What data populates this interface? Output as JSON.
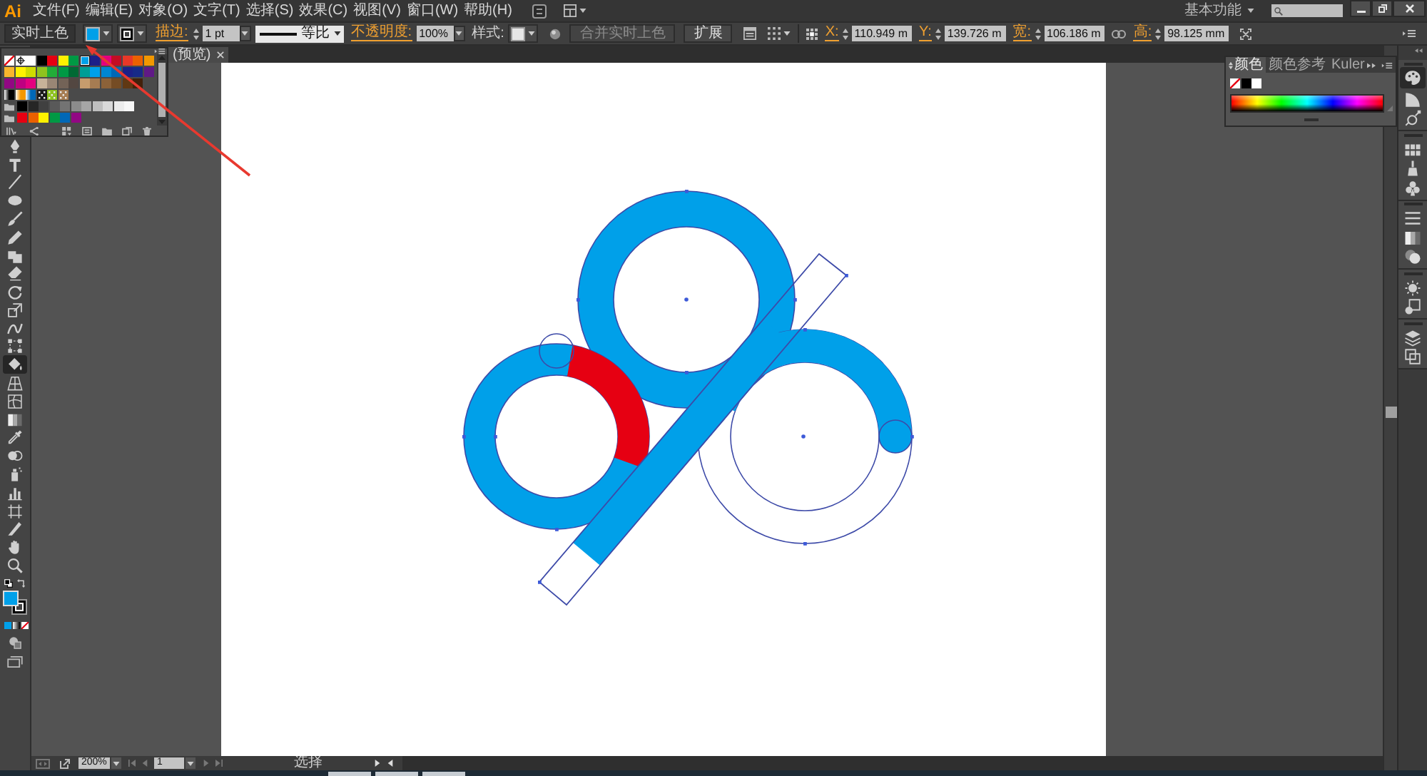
{
  "menu_bar": {
    "logo": "Ai",
    "items": [
      "文件(F)",
      "编辑(E)",
      "对象(O)",
      "文字(T)",
      "选择(S)",
      "效果(C)",
      "视图(V)",
      "窗口(W)",
      "帮助(H)"
    ],
    "workspace": "基本功能"
  },
  "control_bar": {
    "selection": "实时上色",
    "fill": {
      "color": "#00a0e9"
    },
    "stroke_link": "描边:",
    "stroke_weight": "1 pt",
    "stroke_profile": "等比",
    "opacity_link": "不透明度:",
    "opacity": "100%",
    "style_label": "样式:",
    "buttons": [
      {
        "label": "合并实时上色",
        "disabled": true
      },
      {
        "label": "扩展",
        "disabled": false
      }
    ],
    "transform": [
      {
        "label": "X:",
        "value": "110.949 m"
      },
      {
        "label": "Y:",
        "value": "139.726 m"
      },
      {
        "label": "宽:",
        "value": "106.186 m"
      },
      {
        "label": "高:",
        "value": "98.125 mm"
      }
    ]
  },
  "document_tab": {
    "title": "(预览)"
  },
  "swatches_panel": {
    "rows": [
      {
        "kind": "swatches",
        "swatches": [
          {
            "kind": "none",
            "selected": false
          },
          {
            "kind": "registration",
            "selected": false
          },
          {
            "kind": "solid",
            "color": "#ffffff",
            "selected": false
          },
          {
            "kind": "solid",
            "color": "#000000",
            "selected": false
          },
          {
            "kind": "solid",
            "color": "#e60012",
            "selected": false
          },
          {
            "kind": "solid",
            "color": "#fff100",
            "selected": false
          },
          {
            "kind": "solid",
            "color": "#009944",
            "selected": false
          },
          {
            "kind": "solid",
            "color": "#00a0e9",
            "selected": true
          },
          {
            "kind": "solid",
            "color": "#1d2088",
            "selected": false
          },
          {
            "kind": "solid",
            "color": "#e4007f",
            "selected": false
          },
          {
            "kind": "solid",
            "color": "#c30d23",
            "selected": false
          },
          {
            "kind": "solid",
            "color": "#e83828",
            "selected": false
          },
          {
            "kind": "solid",
            "color": "#eb6100",
            "selected": false
          },
          {
            "kind": "solid",
            "color": "#f39800",
            "selected": false
          }
        ]
      },
      {
        "kind": "swatches",
        "swatches": [
          {
            "kind": "solid",
            "color": "#f8b62d",
            "selected": false
          },
          {
            "kind": "solid",
            "color": "#fff100",
            "selected": false
          },
          {
            "kind": "solid",
            "color": "#cfdb00",
            "selected": false
          },
          {
            "kind": "solid",
            "color": "#8fc31f",
            "selected": false
          },
          {
            "kind": "solid",
            "color": "#22ac38",
            "selected": false
          },
          {
            "kind": "solid",
            "color": "#009944",
            "selected": false
          },
          {
            "kind": "solid",
            "color": "#006934",
            "selected": false
          },
          {
            "kind": "solid",
            "color": "#009e96",
            "selected": false
          },
          {
            "kind": "solid",
            "color": "#00a0e9",
            "selected": false
          },
          {
            "kind": "solid",
            "color": "#0086d1",
            "selected": false
          },
          {
            "kind": "solid",
            "color": "#0068b7",
            "selected": false
          },
          {
            "kind": "solid",
            "color": "#1d2088",
            "selected": false
          },
          {
            "kind": "solid",
            "color": "#172a88",
            "selected": false
          },
          {
            "kind": "solid",
            "color": "#601986",
            "selected": false
          }
        ]
      },
      {
        "kind": "swatches",
        "swatches": [
          {
            "kind": "solid",
            "color": "#920783",
            "selected": false
          },
          {
            "kind": "solid",
            "color": "#be0081",
            "selected": false
          },
          {
            "kind": "solid",
            "color": "#e4007f",
            "selected": false
          },
          {
            "kind": "solid",
            "color": "#c7b299",
            "selected": false
          },
          {
            "kind": "solid",
            "color": "#998675",
            "selected": false
          },
          {
            "kind": "solid",
            "color": "#736357",
            "selected": false
          },
          {
            "kind": "solid",
            "color": "#534741",
            "selected": false
          },
          {
            "kind": "solid",
            "color": "#c69c6d",
            "selected": false
          },
          {
            "kind": "solid",
            "color": "#a67c52",
            "selected": false
          },
          {
            "kind": "solid",
            "color": "#8c6239",
            "selected": false
          },
          {
            "kind": "solid",
            "color": "#754c24",
            "selected": false
          },
          {
            "kind": "solid",
            "color": "#603813",
            "selected": false
          },
          {
            "kind": "solid",
            "color": "#42210b",
            "selected": false
          }
        ]
      },
      {
        "kind": "swatches",
        "swatches": [
          {
            "kind": "gradient",
            "color": "#000000",
            "selected": false
          },
          {
            "kind": "gradient",
            "color": "#f39800",
            "selected": false
          },
          {
            "kind": "gradient",
            "color": "#0068b7",
            "selected": false
          },
          {
            "kind": "pattern",
            "color": "#1a1a1a",
            "selected": false
          },
          {
            "kind": "pattern",
            "color": "#8fc31f",
            "selected": false
          },
          {
            "kind": "pattern",
            "color": "#a67c52",
            "selected": false
          }
        ]
      },
      {
        "kind": "group",
        "swatches": [
          {
            "kind": "solid",
            "color": "#000000",
            "selected": false
          },
          {
            "kind": "solid",
            "color": "#262626",
            "selected": false
          },
          {
            "kind": "solid",
            "color": "#404040",
            "selected": false
          },
          {
            "kind": "solid",
            "color": "#595959",
            "selected": false
          },
          {
            "kind": "solid",
            "color": "#737373",
            "selected": false
          },
          {
            "kind": "solid",
            "color": "#8c8c8c",
            "selected": false
          },
          {
            "kind": "solid",
            "color": "#a6a6a6",
            "selected": false
          },
          {
            "kind": "solid",
            "color": "#bfbfbf",
            "selected": false
          },
          {
            "kind": "solid",
            "color": "#d9d9d9",
            "selected": false
          },
          {
            "kind": "solid",
            "color": "#ececec",
            "selected": false
          },
          {
            "kind": "solid",
            "color": "#f7f7f7",
            "selected": false
          }
        ]
      },
      {
        "kind": "group",
        "swatches": [
          {
            "kind": "solid",
            "color": "#e60012",
            "selected": false
          },
          {
            "kind": "solid",
            "color": "#eb6100",
            "selected": false
          },
          {
            "kind": "solid",
            "color": "#fff100",
            "selected": false
          },
          {
            "kind": "solid",
            "color": "#009944",
            "selected": false
          },
          {
            "kind": "solid",
            "color": "#0068b7",
            "selected": false
          },
          {
            "kind": "solid",
            "color": "#920783",
            "selected": false
          }
        ]
      }
    ]
  },
  "tools": [
    {
      "kind": "pen",
      "selected": false
    },
    {
      "kind": "type",
      "selected": false
    },
    {
      "kind": "line",
      "selected": false
    },
    {
      "kind": "ellipse",
      "selected": false
    },
    {
      "kind": "brush",
      "selected": false
    },
    {
      "kind": "pencil",
      "selected": false
    },
    {
      "kind": "blob",
      "selected": false
    },
    {
      "kind": "eraser",
      "selected": false
    },
    {
      "kind": "rotate",
      "selected": false
    },
    {
      "kind": "scale",
      "selected": false
    },
    {
      "kind": "warp",
      "selected": false
    },
    {
      "kind": "transform",
      "selected": false
    },
    {
      "kind": "bucket",
      "selected": true
    },
    {
      "kind": "perspective",
      "selected": false
    },
    {
      "kind": "mesh",
      "selected": false
    },
    {
      "kind": "gradient",
      "selected": false
    },
    {
      "kind": "eyedropper",
      "selected": false
    },
    {
      "kind": "blend",
      "selected": false
    },
    {
      "kind": "sprayer",
      "selected": false
    },
    {
      "kind": "graph",
      "selected": false
    },
    {
      "kind": "artboard",
      "selected": false
    },
    {
      "kind": "knife",
      "selected": false
    },
    {
      "kind": "hand",
      "selected": false
    },
    {
      "kind": "zoom",
      "selected": false
    }
  ],
  "toolbar_fill": {
    "color": "#00a0e9"
  },
  "color_panel": {
    "tabs": [
      {
        "label": "颜色",
        "selected": true
      },
      {
        "label": "颜色参考",
        "selected": false
      },
      {
        "label": "Kuler",
        "selected": false
      }
    ],
    "quick_swatches": [
      {
        "kind": "none"
      },
      {
        "kind": "solid",
        "color": "#000000"
      },
      {
        "kind": "solid",
        "color": "#ffffff"
      }
    ]
  },
  "dock": [
    {
      "icons": [
        {
          "kind": "color",
          "selected": true
        },
        {
          "kind": "color_guide",
          "selected": false
        },
        {
          "kind": "kuler",
          "selected": false
        }
      ]
    },
    {
      "icons": [
        {
          "kind": "swatches",
          "selected": false
        },
        {
          "kind": "brushes",
          "selected": false
        },
        {
          "kind": "symbols",
          "selected": false
        }
      ]
    },
    {
      "icons": [
        {
          "kind": "stroke",
          "selected": false
        },
        {
          "kind": "gradient",
          "selected": false
        },
        {
          "kind": "transparency",
          "selected": false
        }
      ]
    },
    {
      "icons": [
        {
          "kind": "appearance",
          "selected": false
        },
        {
          "kind": "graphic_styles",
          "selected": false
        }
      ]
    },
    {
      "icons": [
        {
          "kind": "layers",
          "selected": false
        },
        {
          "kind": "artboards",
          "selected": false
        }
      ]
    }
  ],
  "status_bar": {
    "zoom": "200%",
    "artboard": "1",
    "tool": "选择"
  }
}
